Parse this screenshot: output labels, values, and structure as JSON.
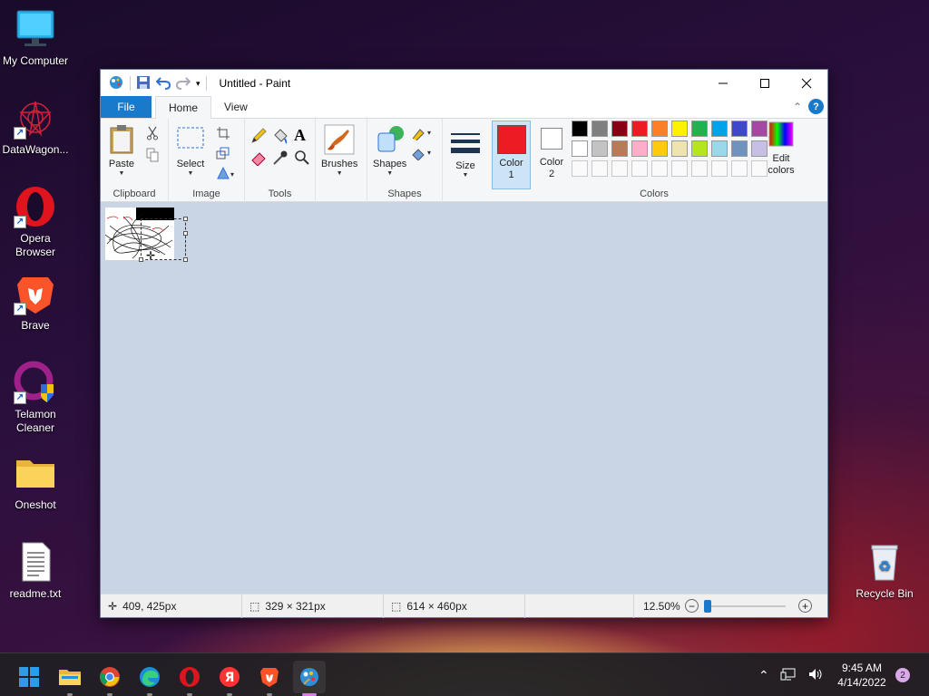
{
  "desktop": {
    "icons": [
      {
        "label": "My Computer"
      },
      {
        "label": "DataWagon..."
      },
      {
        "label": "Opera Browser"
      },
      {
        "label": "Brave"
      },
      {
        "label": "Telamon Cleaner"
      },
      {
        "label": "Oneshot"
      },
      {
        "label": "readme.txt"
      },
      {
        "label": "Recycle Bin"
      }
    ]
  },
  "paint": {
    "title": "Untitled - Paint",
    "tabs": {
      "file": "File",
      "home": "Home",
      "view": "View"
    },
    "clipboard": {
      "paste": "Paste",
      "group": "Clipboard"
    },
    "image": {
      "select": "Select",
      "group": "Image"
    },
    "tools": {
      "group": "Tools"
    },
    "brushes": {
      "label": "Brushes"
    },
    "shapes": {
      "label": "Shapes",
      "group": "Shapes"
    },
    "size": {
      "label": "Size"
    },
    "color1": {
      "label1": "Color",
      "label2": "1",
      "value": "#ed1c24"
    },
    "color2": {
      "label1": "Color",
      "label2": "2",
      "value": "#ffffff"
    },
    "edit_colors": {
      "label1": "Edit",
      "label2": "colors"
    },
    "colors_group": "Colors",
    "palette_row1": [
      "#000000",
      "#7f7f7f",
      "#880015",
      "#ed1c24",
      "#ff7f27",
      "#fff200",
      "#22b14c",
      "#00a2e8",
      "#3f48cc",
      "#a349a4"
    ],
    "palette_row2": [
      "#ffffff",
      "#c3c3c3",
      "#b97a57",
      "#ffaec9",
      "#ffc90e",
      "#efe4b0",
      "#b5e61d",
      "#99d9ea",
      "#7092be",
      "#c8bfe7"
    ],
    "status": {
      "cursor_pos": "409, 425px",
      "selection_size": "329 × 321px",
      "image_size": "614 × 460px",
      "zoom": "12.50%",
      "zoom_fraction": 0.0
    }
  },
  "taskbar": {
    "apps": [
      "start-button",
      "file-explorer",
      "chrome",
      "edge",
      "opera",
      "yandex",
      "brave",
      "paint"
    ],
    "time": "9:45 AM",
    "date": "4/14/2022",
    "notification_count": "2"
  }
}
